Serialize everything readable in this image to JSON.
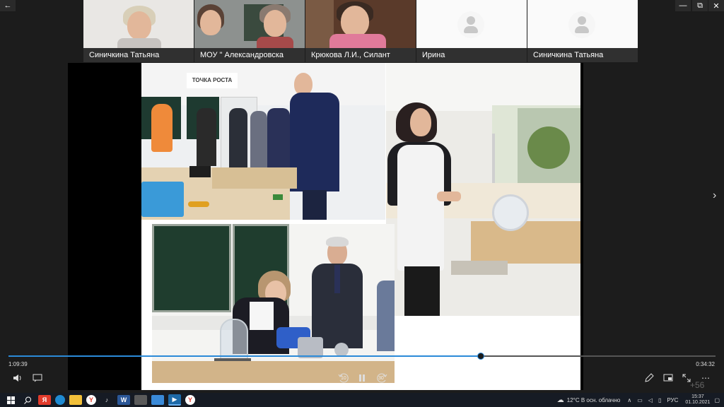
{
  "window": {
    "back_glyph": "←",
    "restore_glyph": "⧉",
    "minimize_glyph": "—",
    "close_glyph": "✕"
  },
  "participants": [
    {
      "name": "Синичкина Татьяна",
      "has_video": true
    },
    {
      "name": "МОУ \" Александровска",
      "has_video": true
    },
    {
      "name": "Крюкова Л.И., Силант",
      "has_video": true
    },
    {
      "name": "Ирина",
      "has_video": false
    },
    {
      "name": "Синичкина Татьяна",
      "has_video": false
    }
  ],
  "slide": {
    "banner_text": "ТОЧКА РОСТА"
  },
  "player": {
    "elapsed": "1:09:39",
    "remaining": "0:34:32",
    "progress": 0.668,
    "rewind_label": "10",
    "forward_label": "30",
    "more_count": "+56",
    "colors": {
      "accent": "#2b8ad8"
    }
  },
  "taskbar": {
    "icons": [
      "windows-start-icon",
      "search-icon",
      "yandex-icon",
      "edge-icon",
      "file-explorer-icon",
      "yandex-browser-icon",
      "music-icon",
      "word-icon",
      "calculator-icon",
      "store-icon",
      "media-player-icon",
      "yandex-app-icon"
    ],
    "weather": "12°C  В осн. облачно",
    "language": "РУС",
    "time": "15:37",
    "date": "01.10.2021"
  }
}
